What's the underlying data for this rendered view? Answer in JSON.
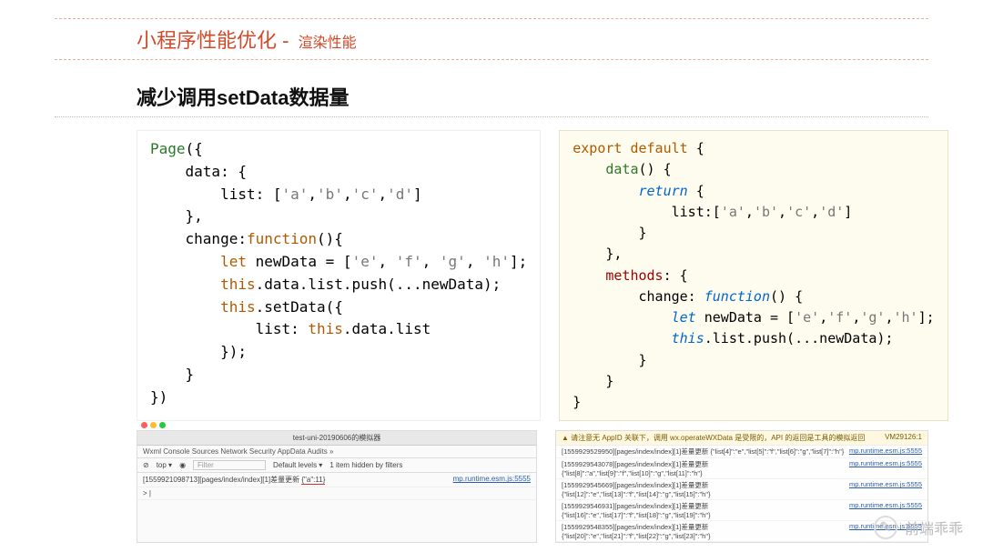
{
  "header": {
    "title_main": "小程序性能优化",
    "title_sep": " - ",
    "title_sub": "渲染性能"
  },
  "section": {
    "heading": "减少调用setData数据量"
  },
  "code_left": {
    "l1_a": "Page",
    "l1_b": "({",
    "l2": "    data: {",
    "l3_a": "        list: [",
    "l3_b": "'a'",
    "l3_c": ",",
    "l3_d": "'b'",
    "l3_e": ",",
    "l3_f": "'c'",
    "l3_g": ",",
    "l3_h": "'d'",
    "l3_i": "]",
    "l4": "    },",
    "l5_a": "    change:",
    "l5_b": "function",
    "l5_c": "(){",
    "l6_a": "        ",
    "l6_b": "let",
    "l6_c": " newData = [",
    "l6_d": "'e'",
    "l6_e": ", ",
    "l6_f": "'f'",
    "l6_g": ", ",
    "l6_h": "'g'",
    "l6_i": ", ",
    "l6_j": "'h'",
    "l6_k": "];",
    "l7_a": "        ",
    "l7_b": "this",
    "l7_c": ".data.list.push(...newData);",
    "l8_a": "        ",
    "l8_b": "this",
    "l8_c": ".setData({",
    "l9_a": "            list: ",
    "l9_b": "this",
    "l9_c": ".data.list",
    "l10": "        });",
    "l11": "    }",
    "l12": "})"
  },
  "code_right": {
    "l1_a": "export default",
    "l1_b": " {",
    "l2_a": "    ",
    "l2_b": "data",
    "l2_c": "() {",
    "l3_a": "        ",
    "l3_b": "return",
    "l3_c": " {",
    "l4_a": "            list:[",
    "l4_b": "'a'",
    "l4_c": ",",
    "l4_d": "'b'",
    "l4_e": ",",
    "l4_f": "'c'",
    "l4_g": ",",
    "l4_h": "'d'",
    "l4_i": "]",
    "l5": "        }",
    "l6": "    },",
    "l7_a": "    ",
    "l7_b": "methods",
    "l7_c": ": {",
    "l8_a": "        change: ",
    "l8_b": "function",
    "l8_c": "() {",
    "l9_a": "            ",
    "l9_b": "let",
    "l9_c": " newData = [",
    "l9_d": "'e'",
    "l9_e": ",",
    "l9_f": "'f'",
    "l9_g": ",",
    "l9_h": "'g'",
    "l9_i": ",",
    "l9_j": "'h'",
    "l9_k": "];",
    "l10_a": "            ",
    "l10_b": "this",
    "l10_c": ".list.push(...newData);",
    "l11": "        }",
    "l12": "    }",
    "l13": "}"
  },
  "console_left": {
    "window_title": "test-uni-20190606的模拟器",
    "tabs": "Wxml   Console   Sources   Network   Security   AppData   Audits   »",
    "tools_stop": "⊘",
    "tools_top": "top ▾",
    "tools_eye": "◉",
    "tools_filter": "Filter",
    "tools_levels": "Default levels ▾",
    "tools_hidden": "1 item hidden by filters",
    "row_msg": "[1559921098713][pages/index/index][1]差量更新",
    "row_obj": "{\"a\":11}",
    "row_link": "mp.runtime.esm.js:5555",
    "prompt": "> |"
  },
  "console_right": {
    "warn_icon": "▲",
    "warn_text": "请注意无 AppID 关联下，调用 wx.operateWXData 是受限的，API 的返回是工具的模拟返回",
    "warn_src": "VM29126:1",
    "rows": [
      {
        "msg": "[1559929529950][pages/index/index][1]差量更新 {\"list[4]\":\"e\",\"list[5]\":\"f\",\"list[6]\":\"g\",\"list[7]\":\"h\"}",
        "link": "mp.runtime.esm.js:5555"
      },
      {
        "msg": "[1559929543078][pages/index/index][1]差量更新 {\"list[8]\":\"a\",\"list[9]\":\"f\",\"list[10]\":\"g\",\"list[11]\":\"h\"}",
        "link": "mp.runtime.esm.js:5555"
      },
      {
        "msg": "[1559929545669][pages/index/index][1]差量更新 {\"list[12]\":\"e\",\"list[13]\":\"f\",\"list[14]\":\"g\",\"list[15]\":\"h\"}",
        "link": "mp.runtime.esm.js:5555"
      },
      {
        "msg": "[1559929546931][pages/index/index][1]差量更新 {\"list[16]\":\"e\",\"list[17]\":\"f\",\"list[18]\":\"g\",\"list[19]\":\"h\"}",
        "link": "mp.runtime.esm.js:5555"
      },
      {
        "msg": "[1559929548355][pages/index/index][1]差量更新 {\"list[20]\":\"e\",\"list[21]\":\"f\",\"list[22]\":\"g\",\"list[23]\":\"h\"}",
        "link": "mp.runtime.esm.js:5555"
      }
    ]
  },
  "watermark": {
    "icon": "✎",
    "text": "前端乖乖"
  }
}
